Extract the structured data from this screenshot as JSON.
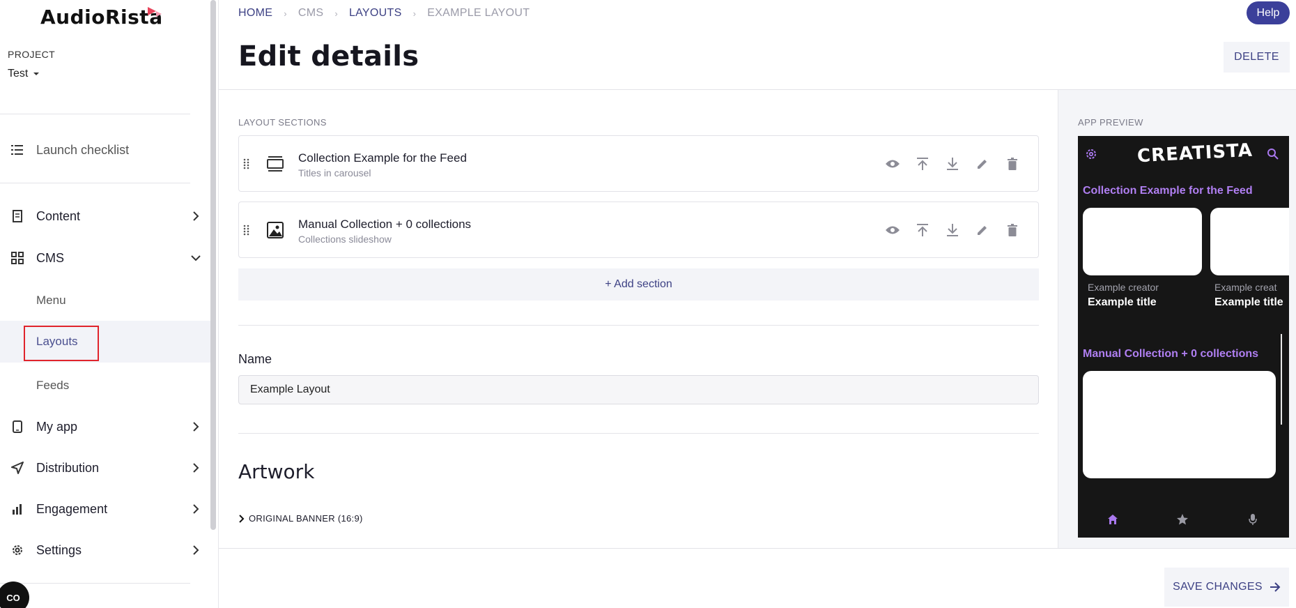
{
  "app": {
    "name": "AudioRista",
    "brand_color": "#e8435a"
  },
  "project": {
    "label": "PROJECT",
    "value": "Test"
  },
  "sidebar": {
    "launch_checklist": "Launch checklist",
    "content": "Content",
    "cms": "CMS",
    "cms_sub": [
      "Menu",
      "Layouts",
      "Feeds"
    ],
    "my_app": "My app",
    "distribution": "Distribution",
    "engagement": "Engagement",
    "settings": "Settings",
    "cookie_label": "CO"
  },
  "breadcrumb": [
    "HOME",
    "CMS",
    "LAYOUTS",
    "EXAMPLE LAYOUT"
  ],
  "help_label": "Help",
  "page_title": "Edit details",
  "delete_label": "DELETE",
  "layout_sections": {
    "caption": "LAYOUT SECTIONS",
    "items": [
      {
        "title": "Collection Example for the Feed",
        "subtitle": "Titles in carousel",
        "icon": "carousel-icon"
      },
      {
        "title": "Manual Collection + 0 collections",
        "subtitle": "Collections slideshow",
        "icon": "image-icon"
      }
    ],
    "add_label": "+ Add section"
  },
  "name_field": {
    "label": "Name",
    "value": "Example Layout"
  },
  "artwork": {
    "title": "Artwork",
    "banner_label": "ORIGINAL BANNER (16:9)"
  },
  "save_label": "SAVE CHANGES",
  "preview": {
    "caption": "APP PREVIEW",
    "logo": "CREATISTA",
    "section1": "Collection Example for the Feed",
    "section2": "Manual Collection + 0 collections",
    "card1_creator": "Example creator",
    "card1_title": "Example title",
    "card2_creator": "Example creat",
    "card2_title": "Example title",
    "accent": "#b07ff2"
  }
}
